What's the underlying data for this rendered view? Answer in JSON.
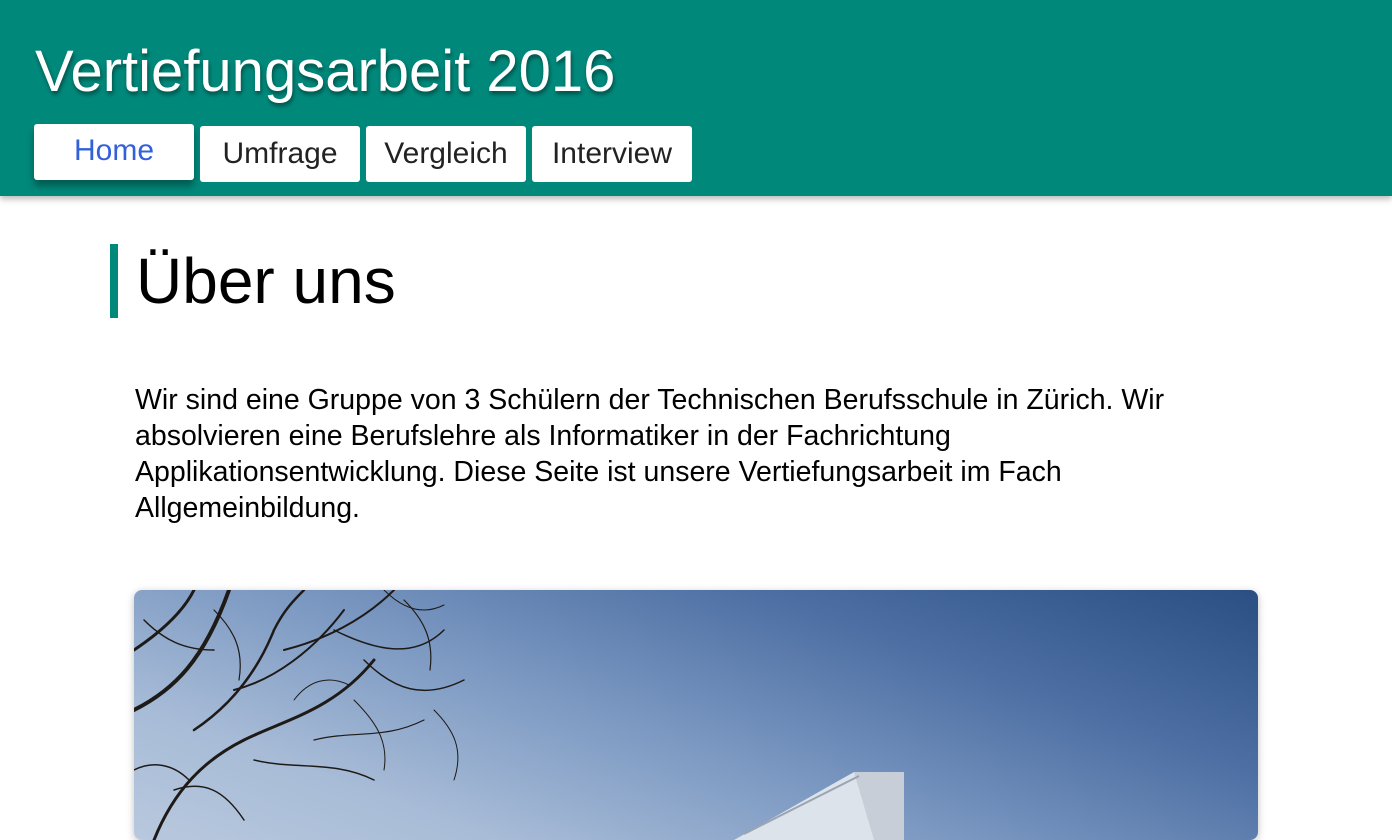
{
  "header": {
    "title": "Vertiefungsarbeit 2016",
    "nav": [
      {
        "label": "Home",
        "active": true
      },
      {
        "label": "Umfrage",
        "active": false
      },
      {
        "label": "Vergleich",
        "active": false
      },
      {
        "label": "Interview",
        "active": false
      }
    ]
  },
  "main": {
    "heading": "Über uns",
    "intro": "Wir sind eine Gruppe von 3 Schülern der Technischen Berufsschule in Zürich. Wir absolvieren eine Berufslehre als Informatiker in der Fachrichtung Applikationsentwicklung. Diese Seite ist unsere Vertiefungsarbeit im Fach Allgemeinbildung."
  },
  "colors": {
    "header_bg": "#00897b",
    "accent": "#00897b",
    "active_link": "#3160d8"
  },
  "icons": {
    "photo": "school-building-photo"
  }
}
